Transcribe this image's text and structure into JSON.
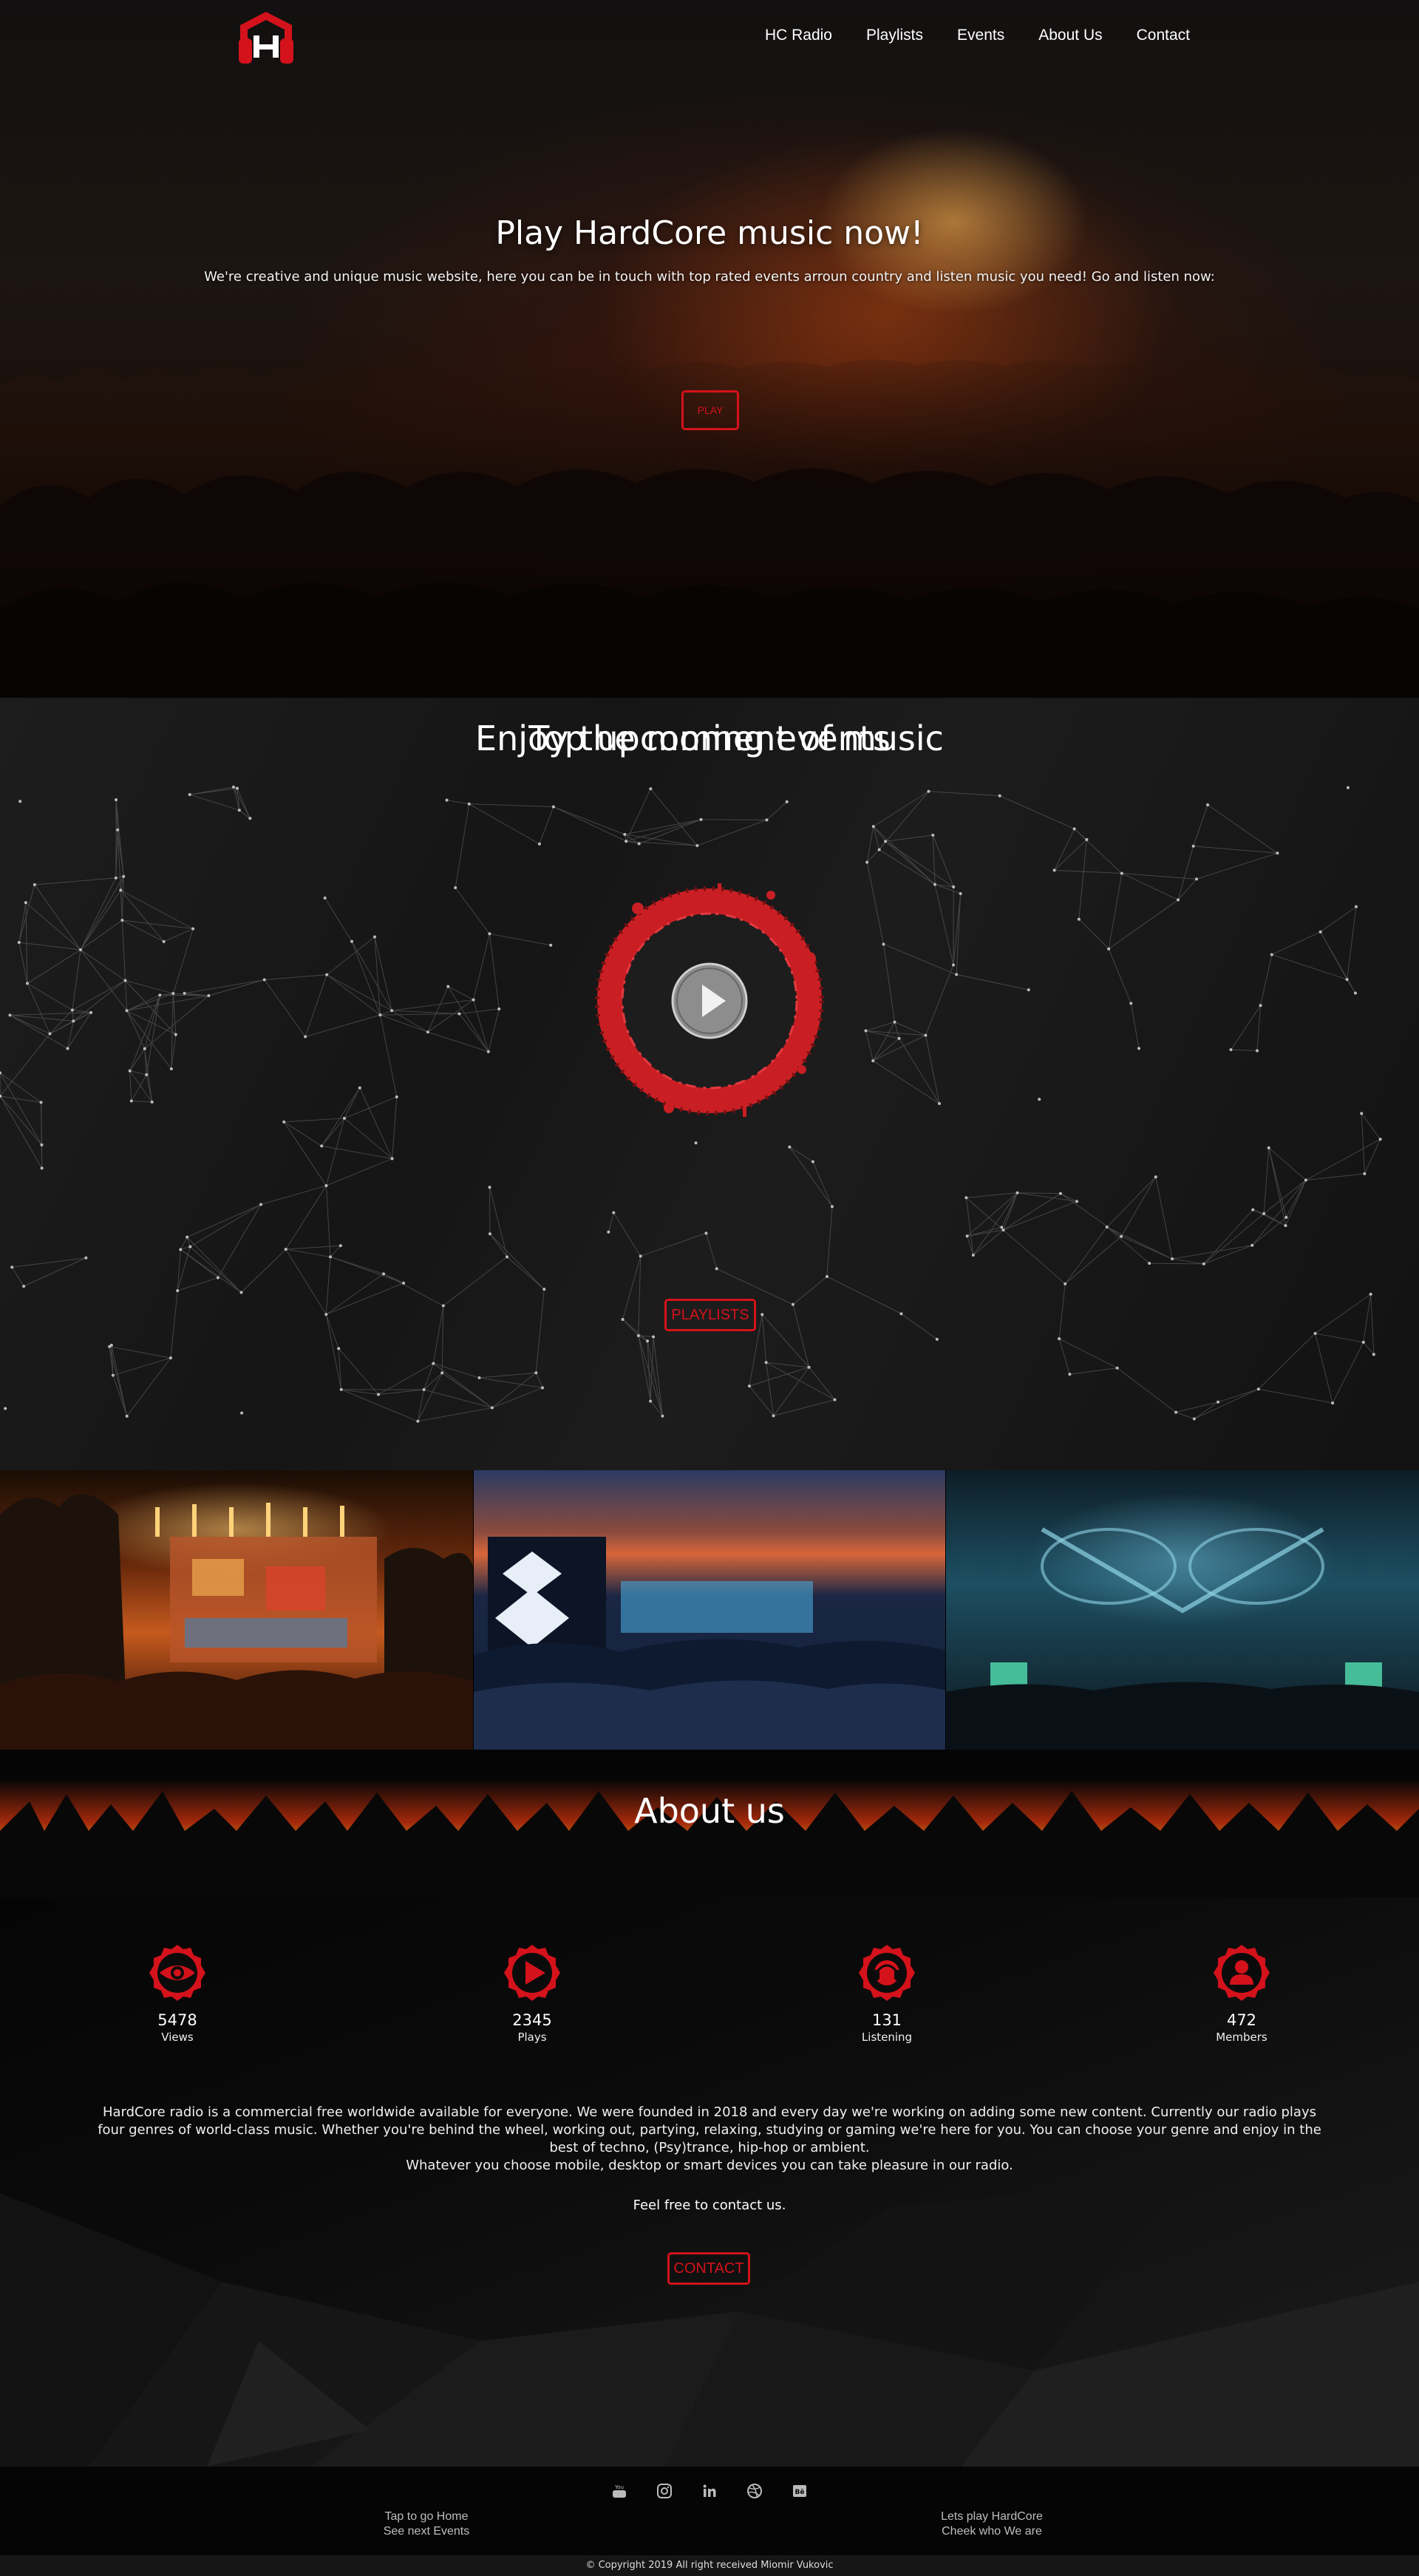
{
  "nav": {
    "links": [
      "HC Radio",
      "Playlists",
      "Events",
      "About Us",
      "Contact"
    ]
  },
  "hero": {
    "title": "Play HardCore music now!",
    "subtitle": "We're creative and unique music website, here you can be in touch with top rated events arroun country and listen music you need! Go and listen now:",
    "button_label": "PLAY"
  },
  "music": {
    "title": "Enjoy the moment of music",
    "playlists_button": "PLAYLISTS"
  },
  "events": {
    "title": "Top upcoming events"
  },
  "about": {
    "title": "About us",
    "stats": [
      {
        "icon": "eye-icon",
        "value": "5478",
        "label": "Views"
      },
      {
        "icon": "play-icon",
        "value": "2345",
        "label": "Plays"
      },
      {
        "icon": "headphones-icon",
        "value": "131",
        "label": "Listening"
      },
      {
        "icon": "user-icon",
        "value": "472",
        "label": "Members"
      }
    ],
    "paragraph": "HardCore radio is a commercial free worldwide available for everyone. We were founded in 2018 and every day we're working on adding some new content. Currently our radio plays four genres of world-class music. Whether you're behind the wheel, working out, partying, relaxing, studying or gaming we're here for you. You can choose your genre and enjoy in the best of techno, (Psy)trance, hip-hop or ambient.",
    "paragraph2": "Whatever you choose mobile, desktop or smart devices you can take pleasure in our radio.",
    "contact_line": "Feel free to contact us.",
    "contact_button": "CONTACT"
  },
  "footer": {
    "social": [
      "youtube-icon",
      "instagram-icon",
      "linkedin-icon",
      "dribbble-icon",
      "behance-icon"
    ],
    "left_link_1": "Tap to go Home",
    "left_link_2": "See next Events",
    "right_link_1": "Lets play HardCore",
    "right_link_2": "Cheek who We are",
    "copyright": "© Copyright 2019 All right received Miomir Vukovic"
  },
  "colors": {
    "accent": "#d4121b",
    "background": "#0b0b0b",
    "text": "#ffffff"
  }
}
